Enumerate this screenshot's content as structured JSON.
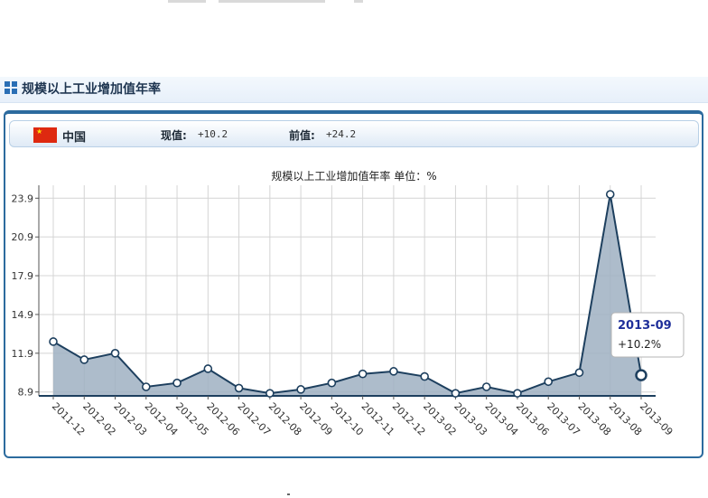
{
  "header": {
    "title": "规模以上工业增加值年率"
  },
  "info": {
    "country": "中国",
    "current_label": "现值:",
    "current_value": "+10.2",
    "previous_label": "前值:",
    "previous_value": "+24.2"
  },
  "tooltip": {
    "title": "2013-09",
    "value": "+10.2%"
  },
  "colors": {
    "line": "#1d3f5e",
    "area": "#9fb0c2",
    "tooltip_title": "#1f2f9a",
    "panel_border": "#2c6b9e"
  },
  "icons": {
    "header_icon": "grid-icon",
    "flag": "china-flag-icon"
  },
  "chart_data": {
    "type": "area",
    "title": "规模以上工业增加值年率 单位：%",
    "xlabel": "",
    "ylabel": "",
    "x": [
      "2011-12",
      "2012-02",
      "2012-03",
      "2012-04",
      "2012-05",
      "2012-06",
      "2012-07",
      "2012-08",
      "2012-09",
      "2012-10",
      "2012-11",
      "2012-12",
      "2013-02",
      "2013-03",
      "2013-04",
      "2013-06",
      "2013-07",
      "2013-08",
      "2013-08",
      "2013-09"
    ],
    "values": [
      12.8,
      11.4,
      11.9,
      9.3,
      9.6,
      10.7,
      9.2,
      8.8,
      9.1,
      9.6,
      10.3,
      10.5,
      10.1,
      8.8,
      9.3,
      8.8,
      9.7,
      10.4,
      24.2,
      10.2
    ],
    "yticks": [
      8.9,
      11.9,
      14.9,
      17.9,
      20.9,
      23.9
    ],
    "ylim": [
      8.6,
      24.9
    ],
    "grid": true,
    "legend": "none",
    "highlight_index": 19
  }
}
